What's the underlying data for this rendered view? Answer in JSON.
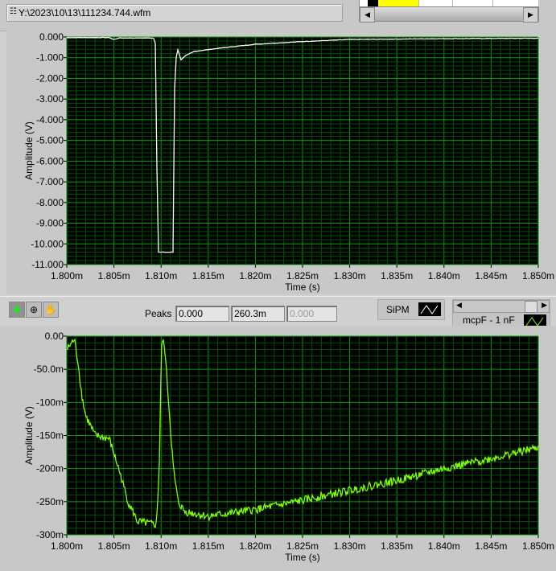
{
  "file_path": "Y:\\2023\\10\\13\\111234.744.wfm",
  "toolbar": {
    "peaks_label": "Peaks",
    "peak_values": [
      "0.000",
      "260.3m",
      "0.000"
    ]
  },
  "legend": {
    "sipm": "SiPM",
    "mcp": "mcpF - 1 nF"
  },
  "colors": {
    "plot_bg": "#000000",
    "grid_major": "#00a000",
    "grid_minor": "#005000",
    "trace_top": "#ffffff",
    "trace_bottom": "#80ff00"
  },
  "chart_data": [
    {
      "type": "line",
      "title": "",
      "xlabel": "Time (s)",
      "ylabel": "Amplitude (V)",
      "xlim": [
        1.8,
        1.85
      ],
      "ylim": [
        -11,
        0
      ],
      "x_ticks": [
        "1.800m",
        "1.805m",
        "1.810m",
        "1.815m",
        "1.820m",
        "1.825m",
        "1.830m",
        "1.835m",
        "1.840m",
        "1.845m",
        "1.850m"
      ],
      "y_ticks": [
        "0.000",
        "-1.000",
        "-2.000",
        "-3.000",
        "-4.000",
        "-5.000",
        "-6.000",
        "-7.000",
        "-8.000",
        "-9.000",
        "-10.000",
        "-11.000"
      ],
      "series": [
        {
          "name": "SiPM",
          "noise": 0.01,
          "points": [
            [
              1.8,
              -0.03
            ],
            [
              1.8045,
              -0.03
            ],
            [
              1.805,
              -0.12
            ],
            [
              1.8055,
              -0.05
            ],
            [
              1.8092,
              -0.05
            ],
            [
              1.8094,
              -0.3
            ],
            [
              1.8095,
              -1.0
            ],
            [
              1.8096,
              -10.4
            ],
            [
              1.8113,
              -10.4
            ],
            [
              1.8114,
              -3.0
            ],
            [
              1.8115,
              -1.5
            ],
            [
              1.8117,
              -0.5
            ],
            [
              1.8119,
              -0.8
            ],
            [
              1.8121,
              -1.1
            ],
            [
              1.8126,
              -0.9
            ],
            [
              1.8135,
              -0.7
            ],
            [
              1.816,
              -0.55
            ],
            [
              1.82,
              -0.35
            ],
            [
              1.825,
              -0.22
            ],
            [
              1.83,
              -0.12
            ],
            [
              1.84,
              -0.08
            ],
            [
              1.85,
              -0.06
            ]
          ]
        }
      ]
    },
    {
      "type": "line",
      "title": "",
      "xlabel": "Time (s)",
      "ylabel": "Amplitude (V)",
      "xlim": [
        1.8,
        1.85
      ],
      "ylim": [
        -0.3,
        0
      ],
      "x_ticks": [
        "1.800m",
        "1.805m",
        "1.810m",
        "1.815m",
        "1.820m",
        "1.825m",
        "1.830m",
        "1.835m",
        "1.840m",
        "1.845m",
        "1.850m"
      ],
      "y_ticks": [
        "0.00",
        "-50.0m",
        "-100m",
        "-150m",
        "-200m",
        "-250m",
        "-300m"
      ],
      "series": [
        {
          "name": "mcpF - 1 nF",
          "noise": 0.006,
          "points": [
            [
              1.8,
              -0.02
            ],
            [
              1.8008,
              -0.005
            ],
            [
              1.8012,
              -0.04
            ],
            [
              1.8016,
              -0.09
            ],
            [
              1.802,
              -0.12
            ],
            [
              1.803,
              -0.15
            ],
            [
              1.8045,
              -0.155
            ],
            [
              1.8055,
              -0.2
            ],
            [
              1.8065,
              -0.25
            ],
            [
              1.8075,
              -0.28
            ],
            [
              1.8095,
              -0.285
            ],
            [
              1.8098,
              -0.2
            ],
            [
              1.81,
              -0.05
            ],
            [
              1.8101,
              -0.002
            ],
            [
              1.8104,
              -0.02
            ],
            [
              1.8108,
              -0.1
            ],
            [
              1.8113,
              -0.2
            ],
            [
              1.8118,
              -0.25
            ],
            [
              1.8125,
              -0.265
            ],
            [
              1.815,
              -0.272
            ],
            [
              1.82,
              -0.262
            ],
            [
              1.825,
              -0.248
            ],
            [
              1.83,
              -0.233
            ],
            [
              1.835,
              -0.218
            ],
            [
              1.84,
              -0.2
            ],
            [
              1.845,
              -0.185
            ],
            [
              1.85,
              -0.168
            ]
          ]
        }
      ]
    }
  ]
}
